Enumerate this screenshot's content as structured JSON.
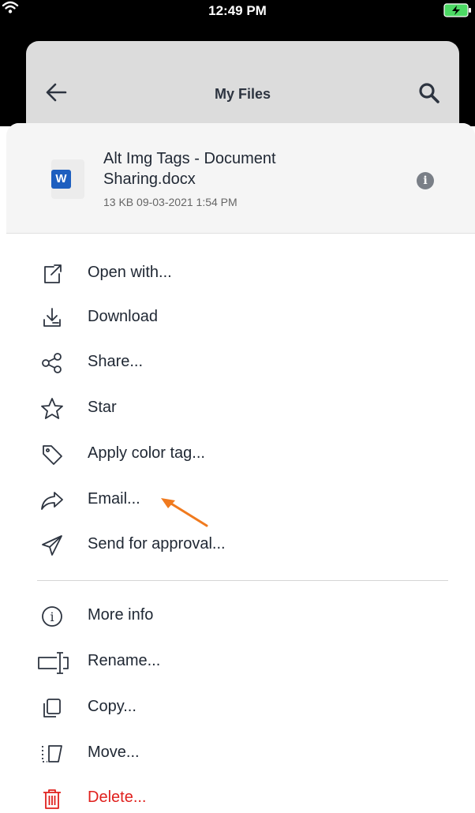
{
  "status_bar": {
    "time": "12:49 PM",
    "wifi_icon": "wifi-icon",
    "battery_icon": "battery-charging-icon"
  },
  "nav": {
    "title": "My Files",
    "back_icon": "back-arrow-icon",
    "search_icon": "search-icon"
  },
  "file": {
    "name": "Alt Img Tags - Document Sharing.docx",
    "meta": "13 KB 09-03-2021 1:54 PM",
    "type_badge": "W",
    "info_icon": "info-icon"
  },
  "menu": {
    "primary": [
      {
        "label": "Open with...",
        "icon": "open-external-icon"
      },
      {
        "label": "Download",
        "icon": "download-icon"
      },
      {
        "label": "Share...",
        "icon": "share-icon"
      },
      {
        "label": "Star",
        "icon": "star-icon"
      },
      {
        "label": "Apply color tag...",
        "icon": "tag-icon"
      },
      {
        "label": "Email...",
        "icon": "email-forward-icon"
      },
      {
        "label": "Send for approval...",
        "icon": "send-icon"
      }
    ],
    "secondary": [
      {
        "label": "More info",
        "icon": "info-circle-icon"
      },
      {
        "label": "Rename...",
        "icon": "rename-icon"
      },
      {
        "label": "Copy...",
        "icon": "copy-icon"
      },
      {
        "label": "Move...",
        "icon": "move-icon"
      },
      {
        "label": "Delete...",
        "icon": "trash-icon",
        "danger": true
      }
    ]
  },
  "colors": {
    "accent_arrow": "#f07a1e",
    "danger": "#e0201d",
    "word_blue": "#1e5fbf"
  }
}
